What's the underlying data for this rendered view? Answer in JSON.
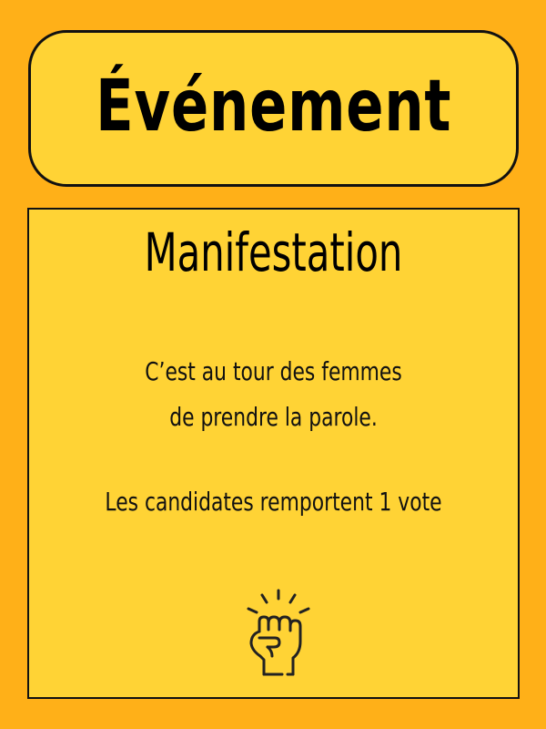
{
  "card": {
    "category": "Événement",
    "event_name": "Manifestation",
    "description_line_1": "C’est au tour des femmes",
    "description_line_2": "de prendre la parole.",
    "effect": "Les candidates remportent 1 vote",
    "icon": "raised-fist-icon"
  },
  "colors": {
    "background": "#FFB018",
    "panel": "#FFD335",
    "outline": "#111111"
  }
}
